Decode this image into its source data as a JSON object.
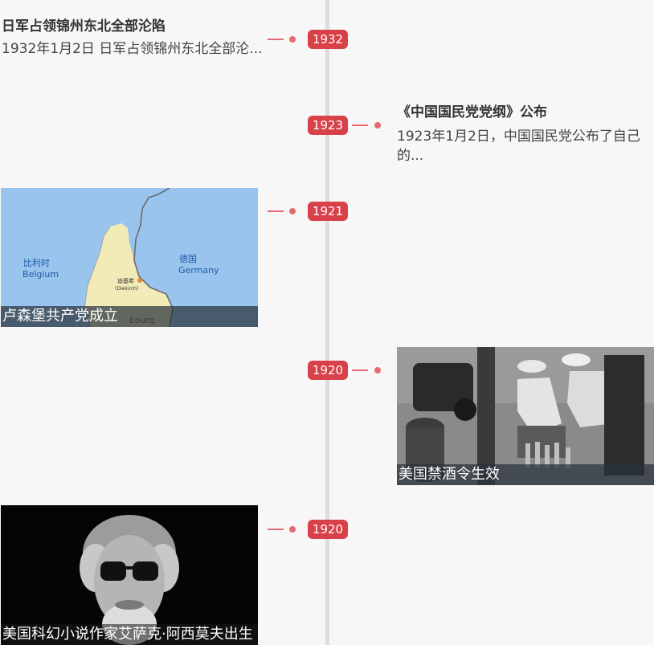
{
  "colors": {
    "accent": "#d9414a",
    "connector": "#e46b70",
    "axis": "#dcdcdc"
  },
  "entries": [
    {
      "year": "1932",
      "title": "日军占领锦州东北全部沦陷",
      "desc": "1932年1月2日 日军占领锦州东北全部沦..."
    },
    {
      "year": "1923",
      "title": "《中国国民党党纲》公布",
      "desc": "1923年1月2日，中国国民党公布了自己的..."
    },
    {
      "year": "1921",
      "caption": "卢森堡共产党成立",
      "map": {
        "label_belgium_cn": "比利时",
        "label_belgium_en": "Belgium",
        "label_germany_cn": "德国",
        "label_germany_en": "Germany",
        "city_cn": "迪基希",
        "city_en": "(Diekirch)",
        "partial_label": "bourg"
      }
    },
    {
      "year": "1920",
      "caption": "美国禁酒令生效"
    },
    {
      "year": "1920",
      "caption": "美国科幻小说作家艾萨克·阿西莫夫出生"
    }
  ]
}
